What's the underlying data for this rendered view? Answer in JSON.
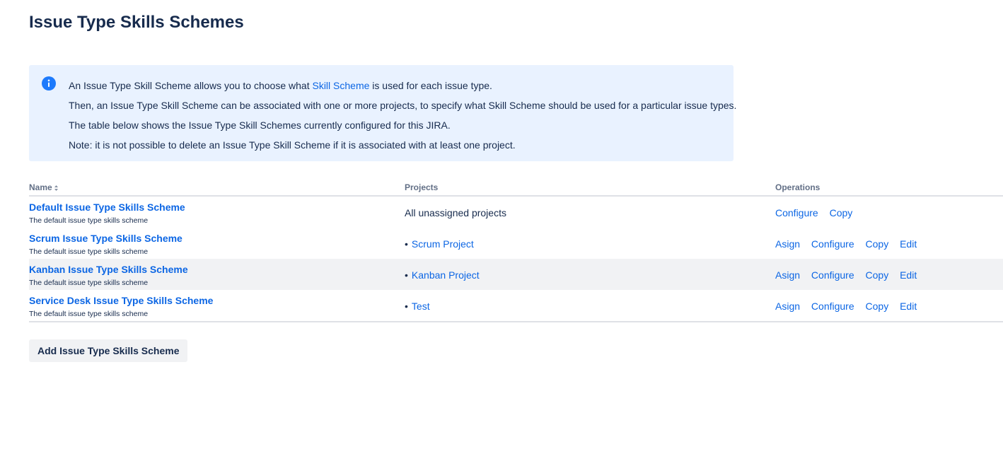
{
  "page": {
    "title": "Issue Type Skills Schemes"
  },
  "info": {
    "icon": "info-icon",
    "accent": "#1d7afc",
    "line1_before": "An Issue Type Skill Scheme allows you to choose what ",
    "line1_link": "Skill Scheme",
    "line1_after": " is used for each issue type.",
    "line2": "Then, an Issue Type Skill Scheme can be associated with one or more projects, to specify what Skill Scheme should be used for a particular issue types.",
    "line3": "The table below shows the Issue Type Skill Schemes currently configured for this JIRA.",
    "line4": "Note: it is not possible to delete an Issue Type Skill Scheme if it is associated with at least one project."
  },
  "table": {
    "headers": {
      "name": "Name",
      "projects": "Projects",
      "operations": "Operations"
    },
    "sort_icon": "sort-icon",
    "rows": [
      {
        "name": "Default Issue Type Skills Scheme",
        "description": "The default issue type skills scheme",
        "project": "All unassigned projects",
        "bullet": "",
        "ops": {
          "configure": "Configure",
          "copy": "Copy"
        }
      },
      {
        "name": "Scrum Issue Type Skills Scheme",
        "description": "The default issue type skills scheme",
        "project": "Scrum Project",
        "bullet": "•",
        "ops": {
          "asign": "Asign",
          "configure": "Configure",
          "copy": "Copy",
          "edit": "Edit"
        }
      },
      {
        "name": "Kanban Issue Type Skills Scheme",
        "description": "The default issue type skills scheme",
        "project": "Kanban Project",
        "bullet": "•",
        "ops": {
          "asign": "Asign",
          "configure": "Configure",
          "copy": "Copy",
          "edit": "Edit"
        }
      },
      {
        "name": "Service Desk Issue Type Skills Scheme",
        "description": "The default issue type skills scheme",
        "project": "Test",
        "bullet": "•",
        "ops": {
          "asign": "Asign",
          "configure": "Configure",
          "copy": "Copy",
          "edit": "Edit"
        }
      }
    ]
  },
  "actions": {
    "add_label": "Add Issue Type Skills Scheme"
  },
  "colors": {
    "link": "#0c66e4",
    "text": "#172b4d",
    "info_bg": "#e9f2ff",
    "row_alt": "#f1f2f4"
  }
}
